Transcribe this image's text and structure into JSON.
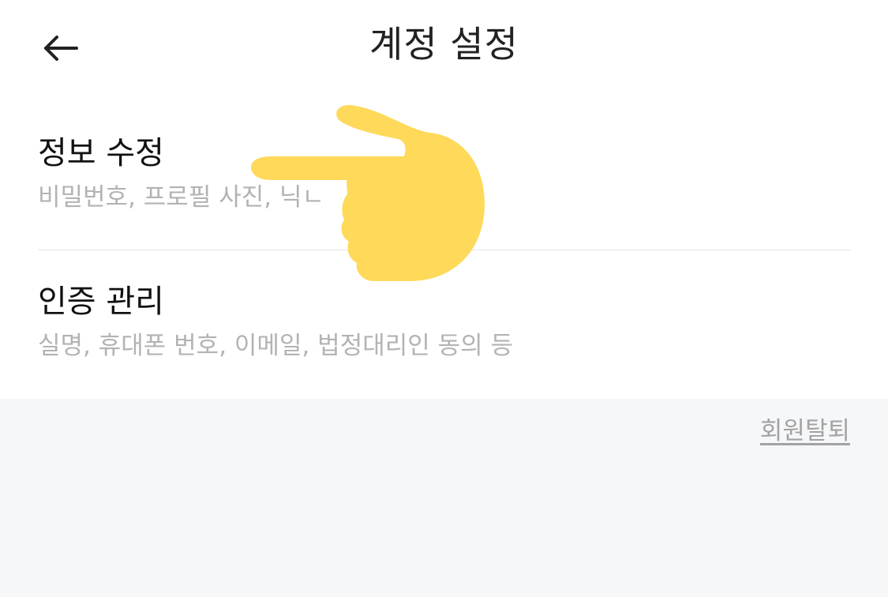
{
  "header": {
    "back_icon": "arrow-left-icon",
    "title": "계정 설정"
  },
  "menu": {
    "items": [
      {
        "title": "정보 수정",
        "description": "비밀번호, 프로필 사진, 닉ㄴ"
      },
      {
        "title": "인증 관리",
        "description": "실명, 휴대폰 번호, 이메일, 법정대리인 동의 등"
      }
    ]
  },
  "footer": {
    "withdraw_label": "회원탈퇴"
  },
  "overlay": {
    "icon": "pointing-hand-icon",
    "color": "#ffd95a"
  },
  "colors": {
    "panel_bg": "#ffffff",
    "page_bg": "#f6f7f9",
    "title_text": "#111111",
    "description_text": "#b3b3b3",
    "link_text": "#a3a3a3"
  }
}
